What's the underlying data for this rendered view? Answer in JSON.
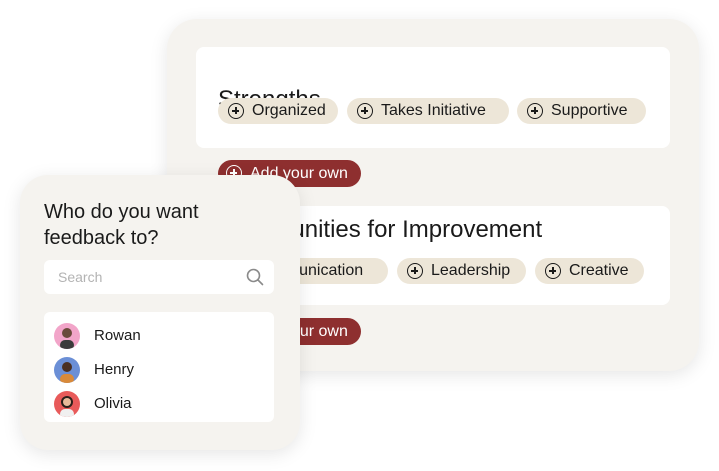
{
  "strengths": {
    "title": "Strengths",
    "chips": [
      "Organized",
      "Takes Initiative",
      "Supportive"
    ],
    "add_label": "Add your own"
  },
  "improvement": {
    "title": "Opportunities for Improvement",
    "chips": [
      "Communication",
      "Leadership",
      "Creative"
    ],
    "add_label": "Add your own"
  },
  "feedback": {
    "question": "Who do you want feedback to?",
    "search_placeholder": "Search",
    "people": [
      {
        "name": "Rowan",
        "avatar_color": "#f2a5c9"
      },
      {
        "name": "Henry",
        "avatar_color": "#6b8fd6"
      },
      {
        "name": "Olivia",
        "avatar_color": "#e85a5a"
      }
    ]
  },
  "colors": {
    "panel": "#f5f3ef",
    "chip": "#ede6d8",
    "accent": "#8e2f2f"
  }
}
